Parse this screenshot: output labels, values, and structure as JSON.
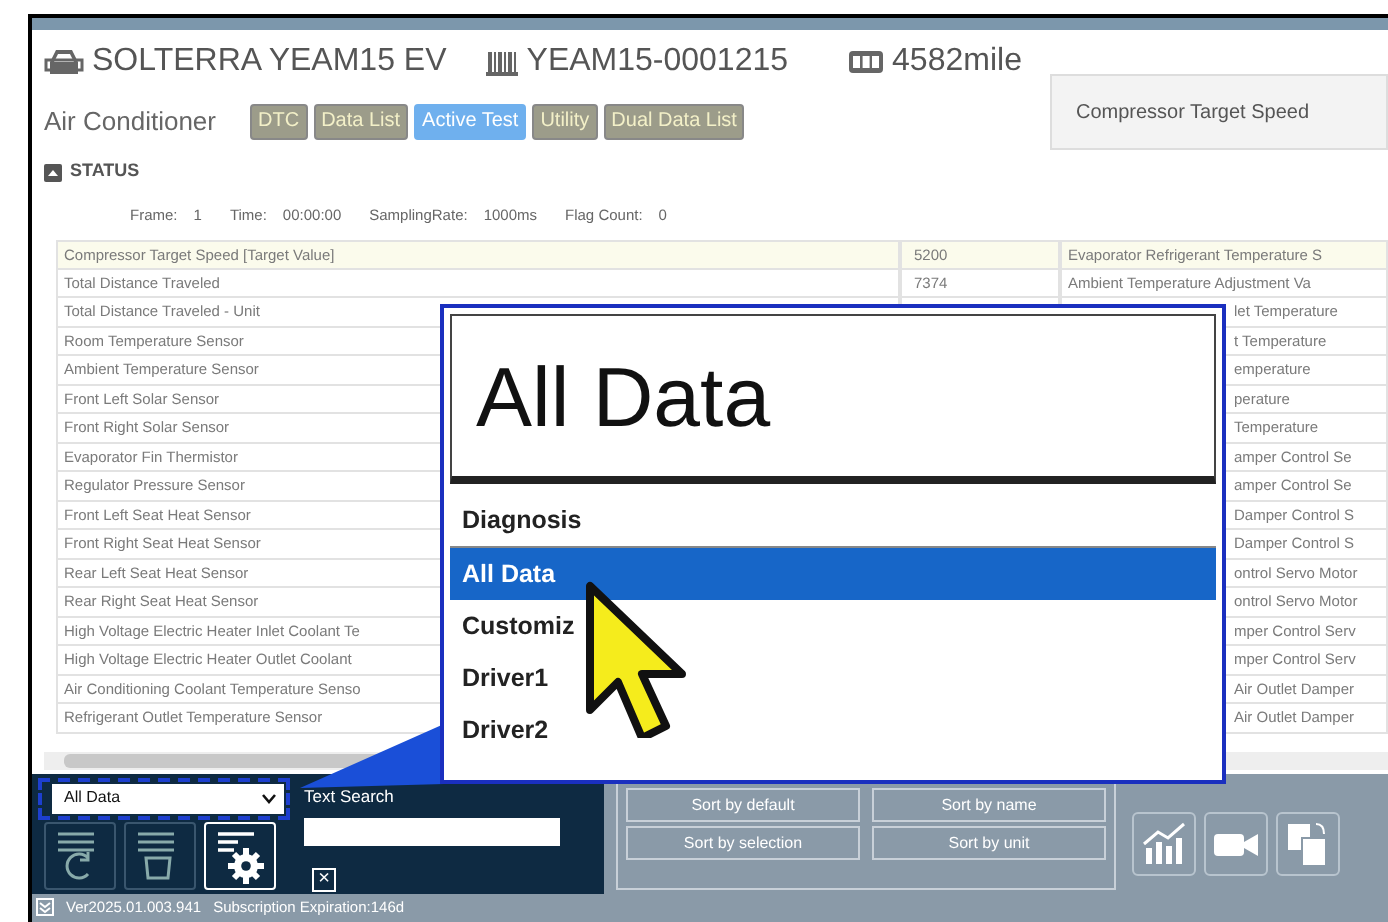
{
  "vehicle": {
    "name": "SOLTERRA YEAM15 EV",
    "vin": "YEAM15-0001215",
    "mileage": "4582mile"
  },
  "system": "Air Conditioner",
  "tabs": [
    {
      "label": "DTC",
      "selected": false
    },
    {
      "label": "Data List",
      "selected": false
    },
    {
      "label": "Active Test",
      "selected": true
    },
    {
      "label": "Utility",
      "selected": false
    },
    {
      "label": "Dual Data List",
      "selected": false
    }
  ],
  "target_box": "Compressor Target Speed",
  "status": {
    "title": "STATUS",
    "fields": [
      {
        "label": "Frame:",
        "value": "1"
      },
      {
        "label": "Time:",
        "value": "00:00:00"
      },
      {
        "label": "SamplingRate:",
        "value": "1000ms"
      },
      {
        "label": "Flag Count:",
        "value": "0"
      }
    ]
  },
  "table": {
    "rows": [
      {
        "name": "Compressor Target Speed [Target Value]",
        "value": "5200",
        "name_2": "Evaporator Refrigerant Temperature S",
        "selected": true
      },
      {
        "name": "Total Distance Traveled",
        "value": "7374",
        "name_2": "Ambient Temperature Adjustment Va",
        "selected": false
      },
      {
        "name": "Total Distance Traveled - Unit",
        "name_2": "let Temperature",
        "selected": false
      },
      {
        "name": "Room Temperature Sensor",
        "name_2": "t Temperature",
        "selected": false
      },
      {
        "name": "Ambient Temperature Sensor",
        "name_2": "emperature",
        "selected": false
      },
      {
        "name": "Front Left Solar Sensor",
        "name_2": "perature",
        "selected": false
      },
      {
        "name": "Front Right Solar Sensor",
        "name_2": "Temperature",
        "selected": false
      },
      {
        "name": "Evaporator Fin Thermistor",
        "name_2": "amper Control Se",
        "selected": false
      },
      {
        "name": "Regulator Pressure Sensor",
        "name_2": "amper Control Se",
        "selected": false
      },
      {
        "name": "Front Left Seat Heat Sensor",
        "name_2": "Damper Control S",
        "selected": false
      },
      {
        "name": "Front Right Seat Heat Sensor",
        "name_2": "Damper Control S",
        "selected": false
      },
      {
        "name": "Rear Left Seat Heat Sensor",
        "name_2": "ontrol Servo Motor",
        "selected": false
      },
      {
        "name": "Rear Right Seat Heat Sensor",
        "name_2": "ontrol Servo Motor",
        "selected": false
      },
      {
        "name": "High Voltage Electric Heater Inlet Coolant Te",
        "name_2": "mper Control Serv",
        "selected": false
      },
      {
        "name": "High Voltage Electric Heater Outlet Coolant",
        "name_2": "mper Control Serv",
        "selected": false
      },
      {
        "name": "Air Conditioning Coolant Temperature Senso",
        "name_2": "Air Outlet Damper",
        "selected": false
      },
      {
        "name": "Refrigerant Outlet Temperature Sensor",
        "name_2": "Air Outlet Damper",
        "selected": false
      }
    ]
  },
  "toolbar": {
    "view_select": "All Data",
    "search_label": "Text Search",
    "clear": "×",
    "tool_buttons": [
      {
        "kind": "refresh",
        "selected": false
      },
      {
        "kind": "delete",
        "selected": false
      },
      {
        "kind": "settings",
        "selected": true
      }
    ],
    "sort_buttons": [
      "Sort by default",
      "Sort by name",
      "Sort by selection",
      "Sort by unit"
    ],
    "view_buttons": [
      {
        "kind": "chart"
      },
      {
        "kind": "camera"
      },
      {
        "kind": "export"
      }
    ]
  },
  "status_bar": {
    "version": "Ver2025.01.003.941",
    "subscription": "Subscription Expiration:146d"
  },
  "callout": {
    "value": "All Data",
    "options": [
      {
        "label": "Diagnosis",
        "selected": false
      },
      {
        "label": "All Data",
        "selected": true
      },
      {
        "label": "Customiz",
        "selected": false
      },
      {
        "label": "Driver1",
        "selected": false
      },
      {
        "label": "Driver2",
        "selected": false
      }
    ]
  }
}
